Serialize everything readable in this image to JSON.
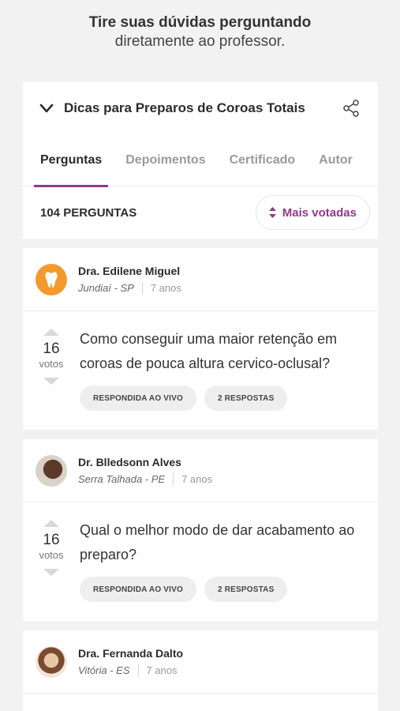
{
  "hero": {
    "title": "Tire suas dúvidas perguntando",
    "subtitle": "diretamente ao professor."
  },
  "course": {
    "title": "Dicas para Preparos de Coroas Totais",
    "tabs": [
      {
        "label": "Perguntas",
        "active": true
      },
      {
        "label": "Depoimentos",
        "active": false
      },
      {
        "label": "Certificado",
        "active": false
      },
      {
        "label": "Autor",
        "active": false
      }
    ],
    "count_label": "104 PERGUNTAS",
    "sort_label": "Mais votadas"
  },
  "questions": [
    {
      "author": "Dra. Edilene Miguel",
      "location": "Jundiaí - SP",
      "age": "7 anos",
      "votes": "16",
      "votes_label": "votos",
      "text": "Como conseguir uma maior retenção em coroas de pouca altura cervico-oclusal?",
      "tags": [
        "RESPONDIDA AO VIVO",
        "2 RESPOSTAS"
      ]
    },
    {
      "author": "Dr. Blledsonn Alves",
      "location": "Serra Talhada - PE",
      "age": "7 anos",
      "votes": "16",
      "votes_label": "votos",
      "text": "Qual o melhor modo de dar acabamento ao preparo?",
      "tags": [
        "RESPONDIDA AO VIVO",
        "2 RESPOSTAS"
      ]
    },
    {
      "author": "Dra. Fernanda Dalto",
      "location": "Vitória - ES",
      "age": "7 anos"
    }
  ],
  "colors": {
    "accent": "#8e3a8b",
    "avatar_orange": "#f29a2e",
    "background": "#f2f2f2"
  }
}
